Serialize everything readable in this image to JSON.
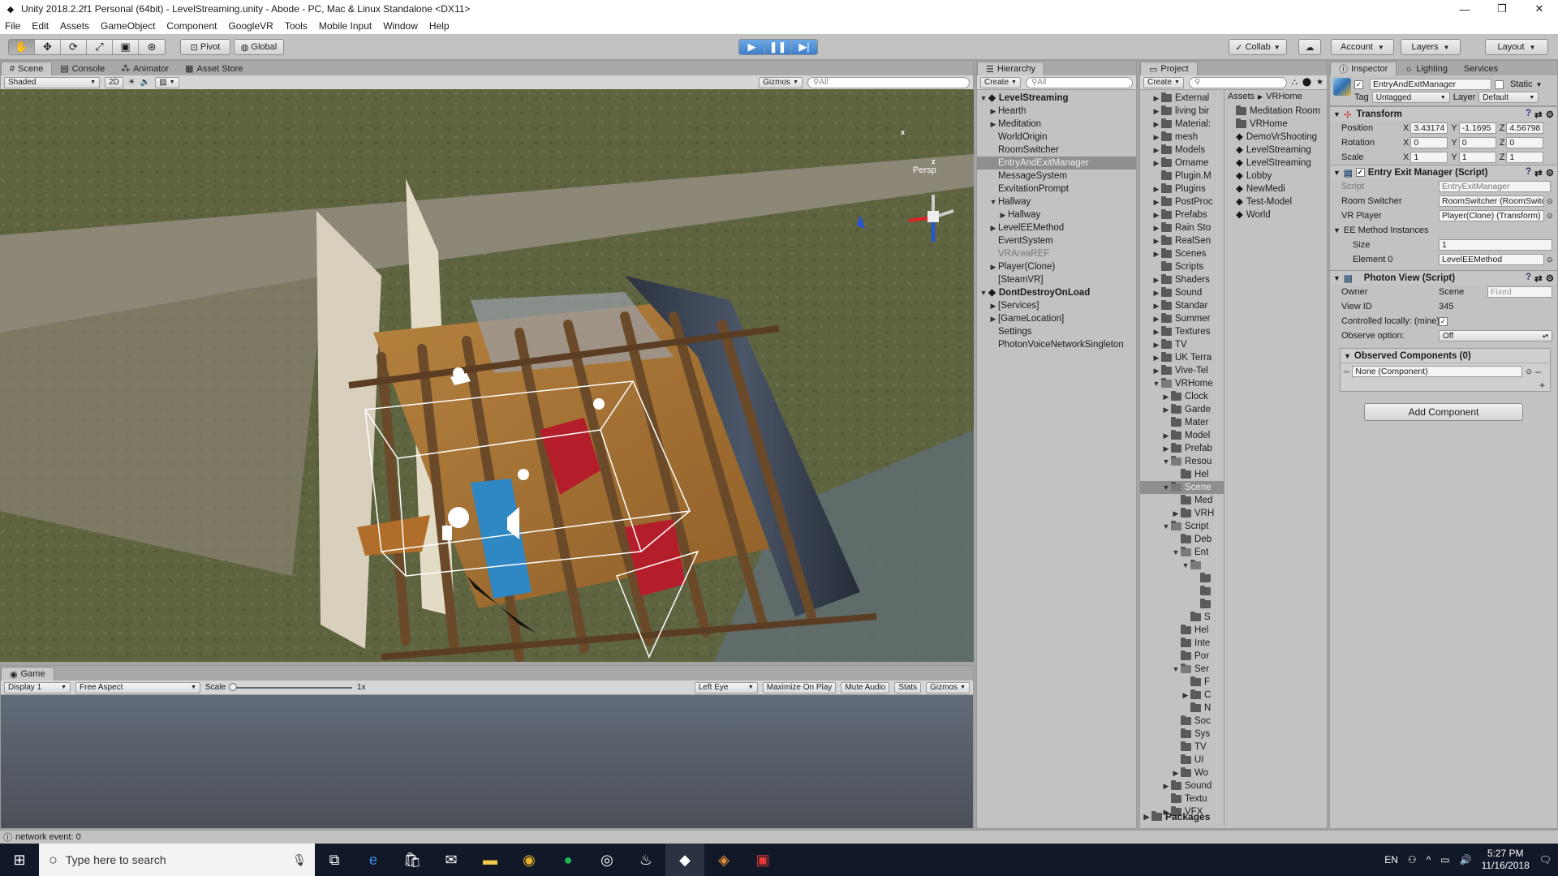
{
  "window": {
    "title": "Unity 2018.2.2f1 Personal (64bit) - LevelStreaming.unity - Abode - PC, Mac & Linux Standalone <DX11>",
    "min": "—",
    "max": "❐",
    "close": "✕"
  },
  "menu": [
    "File",
    "Edit",
    "Assets",
    "GameObject",
    "Component",
    "GoogleVR",
    "Tools",
    "Mobile Input",
    "Window",
    "Help"
  ],
  "toolbar": {
    "pivot": "Pivot",
    "global": "Global",
    "collab": "Collab",
    "account": "Account",
    "layers": "Layers",
    "layout": "Layout"
  },
  "scene": {
    "tabs": [
      "Scene",
      "Console",
      "Animator",
      "Asset Store"
    ],
    "shaded": "Shaded",
    "mode2d": "2D",
    "gizmos": "Gizmos",
    "search": "All",
    "persp": "Persp",
    "axis_x": "x",
    "axis_z": "z"
  },
  "game": {
    "tab": "Game",
    "display": "Display 1",
    "aspect": "Free Aspect",
    "scale": "Scale",
    "scale_val": "1x",
    "left_eye": "Left Eye",
    "maximize": "Maximize On Play",
    "mute": "Mute Audio",
    "stats": "Stats",
    "gizmos": "Gizmos"
  },
  "hierarchy": {
    "tab": "Hierarchy",
    "create": "Create",
    "search": "All",
    "items": [
      {
        "label": "LevelStreaming",
        "indent": 0,
        "arrow": "▼",
        "cls": "bold"
      },
      {
        "label": "Hearth",
        "indent": 1,
        "arrow": "▶",
        "cls": ""
      },
      {
        "label": "Meditation",
        "indent": 1,
        "arrow": "▶",
        "cls": ""
      },
      {
        "label": "WorldOrigin",
        "indent": 1,
        "arrow": "",
        "cls": ""
      },
      {
        "label": "RoomSwitcher",
        "indent": 1,
        "arrow": "",
        "cls": ""
      },
      {
        "label": "EntryAndExitManager",
        "indent": 1,
        "arrow": "",
        "cls": "sel"
      },
      {
        "label": "MessageSystem",
        "indent": 1,
        "arrow": "",
        "cls": ""
      },
      {
        "label": "ExvitationPrompt",
        "indent": 1,
        "arrow": "",
        "cls": ""
      },
      {
        "label": "Hallway",
        "indent": 1,
        "arrow": "▼",
        "cls": ""
      },
      {
        "label": "Hallway",
        "indent": 2,
        "arrow": "▶",
        "cls": ""
      },
      {
        "label": "LevelEEMethod",
        "indent": 1,
        "arrow": "▶",
        "cls": ""
      },
      {
        "label": "EventSystem",
        "indent": 1,
        "arrow": "",
        "cls": ""
      },
      {
        "label": "VRAreaREF",
        "indent": 1,
        "arrow": "",
        "cls": "grey"
      },
      {
        "label": "Player(Clone)",
        "indent": 1,
        "arrow": "▶",
        "cls": ""
      },
      {
        "label": "[SteamVR]",
        "indent": 1,
        "arrow": "",
        "cls": ""
      },
      {
        "label": "DontDestroyOnLoad",
        "indent": 0,
        "arrow": "▼",
        "cls": "bold"
      },
      {
        "label": "[Services]",
        "indent": 1,
        "arrow": "▶",
        "cls": ""
      },
      {
        "label": "[GameLocation]",
        "indent": 1,
        "arrow": "▶",
        "cls": ""
      },
      {
        "label": "Settings",
        "indent": 1,
        "arrow": "",
        "cls": ""
      },
      {
        "label": "PhotonVoiceNetworkSingleton",
        "indent": 1,
        "arrow": "",
        "cls": ""
      }
    ]
  },
  "project": {
    "tab": "Project",
    "create": "Create",
    "breadcrumb_root": "Assets",
    "breadcrumb_leaf": "VRHome",
    "packages": "Packages",
    "tree": [
      {
        "label": "External",
        "indent": 1,
        "arrow": "▶"
      },
      {
        "label": "living bir",
        "indent": 1,
        "arrow": "▶"
      },
      {
        "label": "Material:",
        "indent": 1,
        "arrow": "▶"
      },
      {
        "label": "mesh",
        "indent": 1,
        "arrow": "▶"
      },
      {
        "label": "Models",
        "indent": 1,
        "arrow": "▶"
      },
      {
        "label": "Orname",
        "indent": 1,
        "arrow": "▶"
      },
      {
        "label": "Plugin.M",
        "indent": 1,
        "arrow": ""
      },
      {
        "label": "Plugins",
        "indent": 1,
        "arrow": "▶"
      },
      {
        "label": "PostProc",
        "indent": 1,
        "arrow": "▶"
      },
      {
        "label": "Prefabs",
        "indent": 1,
        "arrow": "▶"
      },
      {
        "label": "Rain Sto",
        "indent": 1,
        "arrow": "▶"
      },
      {
        "label": "RealSen",
        "indent": 1,
        "arrow": "▶"
      },
      {
        "label": "Scenes",
        "indent": 1,
        "arrow": "▶"
      },
      {
        "label": "Scripts",
        "indent": 1,
        "arrow": ""
      },
      {
        "label": "Shaders",
        "indent": 1,
        "arrow": "▶"
      },
      {
        "label": "Sound",
        "indent": 1,
        "arrow": "▶"
      },
      {
        "label": "Standar",
        "indent": 1,
        "arrow": "▶"
      },
      {
        "label": "Summer",
        "indent": 1,
        "arrow": "▶"
      },
      {
        "label": "Textures",
        "indent": 1,
        "arrow": "▶"
      },
      {
        "label": "TV",
        "indent": 1,
        "arrow": "▶"
      },
      {
        "label": "UK Terra",
        "indent": 1,
        "arrow": "▶"
      },
      {
        "label": "Vive-Tel",
        "indent": 1,
        "arrow": "▶"
      },
      {
        "label": "VRHome",
        "indent": 1,
        "arrow": "▼"
      },
      {
        "label": "Clock",
        "indent": 2,
        "arrow": "▶"
      },
      {
        "label": "Garde",
        "indent": 2,
        "arrow": "▶"
      },
      {
        "label": "Mater",
        "indent": 2,
        "arrow": ""
      },
      {
        "label": "Model",
        "indent": 2,
        "arrow": "▶"
      },
      {
        "label": "Prefab",
        "indent": 2,
        "arrow": "▶"
      },
      {
        "label": "Resou",
        "indent": 2,
        "arrow": "▼"
      },
      {
        "label": "Hel",
        "indent": 3,
        "arrow": ""
      },
      {
        "label": "Scene",
        "indent": 2,
        "arrow": "▼",
        "sel": true
      },
      {
        "label": "Med",
        "indent": 3,
        "arrow": ""
      },
      {
        "label": "VRH",
        "indent": 3,
        "arrow": "▶"
      },
      {
        "label": "Script",
        "indent": 2,
        "arrow": "▼"
      },
      {
        "label": "Deb",
        "indent": 3,
        "arrow": ""
      },
      {
        "label": "Ent",
        "indent": 3,
        "arrow": "▼"
      },
      {
        "label": "",
        "indent": 4,
        "arrow": "▼"
      },
      {
        "label": "",
        "indent": 5,
        "arrow": ""
      },
      {
        "label": "",
        "indent": 5,
        "arrow": ""
      },
      {
        "label": "",
        "indent": 5,
        "arrow": ""
      },
      {
        "label": "S",
        "indent": 4,
        "arrow": ""
      },
      {
        "label": "Hel",
        "indent": 3,
        "arrow": ""
      },
      {
        "label": "Inte",
        "indent": 3,
        "arrow": ""
      },
      {
        "label": "Por",
        "indent": 3,
        "arrow": ""
      },
      {
        "label": "Ser",
        "indent": 3,
        "arrow": "▼"
      },
      {
        "label": "F",
        "indent": 4,
        "arrow": ""
      },
      {
        "label": "C",
        "indent": 4,
        "arrow": "▶"
      },
      {
        "label": "N",
        "indent": 4,
        "arrow": ""
      },
      {
        "label": "Soc",
        "indent": 3,
        "arrow": ""
      },
      {
        "label": "Sys",
        "indent": 3,
        "arrow": ""
      },
      {
        "label": "TV",
        "indent": 3,
        "arrow": ""
      },
      {
        "label": "UI",
        "indent": 3,
        "arrow": ""
      },
      {
        "label": "Wo",
        "indent": 3,
        "arrow": "▶"
      },
      {
        "label": "Sound",
        "indent": 2,
        "arrow": "▶"
      },
      {
        "label": "Textu",
        "indent": 2,
        "arrow": ""
      },
      {
        "label": "VFX",
        "indent": 2,
        "arrow": "▶"
      }
    ],
    "files": [
      "Meditation Room",
      "VRHome",
      "DemoVrShooting",
      "LevelStreaming",
      "LevelStreaming",
      "Lobby",
      "NewMedi",
      "Test-Model",
      "World"
    ]
  },
  "inspector": {
    "tabs": [
      "Inspector",
      "Lighting",
      "Services"
    ],
    "object_name": "EntryAndExitManager",
    "static": "Static",
    "tag_label": "Tag",
    "tag": "Untagged",
    "layer_label": "Layer",
    "layer": "Default",
    "transform": {
      "title": "Transform",
      "rows": [
        {
          "label": "Position",
          "x": "3.43174",
          "y": "-1.1695",
          "z": "4.56798"
        },
        {
          "label": "Rotation",
          "x": "0",
          "y": "0",
          "z": "0"
        },
        {
          "label": "Scale",
          "x": "1",
          "y": "1",
          "z": "1"
        }
      ]
    },
    "eem": {
      "title": "Entry Exit Manager (Script)",
      "script_label": "Script",
      "script": "EntryExitManager",
      "room_label": "Room Switcher",
      "room": "RoomSwitcher (RoomSwitcher)",
      "vr_label": "VR Player",
      "vr": "Player(Clone) (Transform)",
      "instances": "EE Method Instances",
      "size_label": "Size",
      "size": "1",
      "el_label": "Element 0",
      "el": "LevelEEMethod"
    },
    "photon": {
      "title": "Photon View (Script)",
      "owner_label": "Owner",
      "owner": "Scene",
      "fixed": "Fixed",
      "viewid_label": "View ID",
      "viewid": "345",
      "ctrl_label": "Controlled locally: (mine)",
      "observe_label": "Observe option:",
      "observe": "Off",
      "observed": "Observed Components (0)",
      "none": "None (Component)"
    },
    "add": "Add Component"
  },
  "status": "network event: 0",
  "taskbar": {
    "search": "Type here to search",
    "lang": "EN",
    "time": "5:27 PM",
    "date": "11/16/2018"
  }
}
